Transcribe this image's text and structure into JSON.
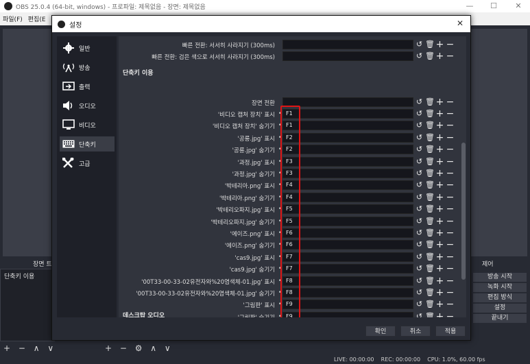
{
  "window": {
    "title": "OBS 25.0.4 (64-bit, windows) - 프로파일: 제목없음 - 장면: 제목없음",
    "minimize": "—",
    "maximize": "☐",
    "close": "✕"
  },
  "menu": {
    "file": "파일(F)",
    "edit": "편집(E"
  },
  "docks": {
    "scenes_title": "장면 트",
    "scene_item": "단축키 이용",
    "controls_title": "제어",
    "controls": [
      "방송 시작",
      "녹화 시작",
      "편집 방식",
      "설정",
      "끝내기"
    ],
    "bottom_left_tools": "+ − ∧ ∨",
    "bottom_mid_tools": "+ − ⚙ ∧ ∨"
  },
  "status": {
    "text": "LIVE: 00:00:00    REC: 00:00:00    CPU: 1.0%, 60.00 fps"
  },
  "dialog": {
    "title": "설정",
    "close": "✕",
    "sidebar": [
      {
        "label": "일반",
        "icon": "gear-icon"
      },
      {
        "label": "방송",
        "icon": "broadcast-icon"
      },
      {
        "label": "출력",
        "icon": "output-icon"
      },
      {
        "label": "오디오",
        "icon": "speaker-icon"
      },
      {
        "label": "비디오",
        "icon": "monitor-icon"
      },
      {
        "label": "단축키",
        "icon": "keyboard-icon",
        "active": true
      },
      {
        "label": "고급",
        "icon": "tools-icon"
      }
    ],
    "top_rows": [
      {
        "label": "빠른 전환: 서서히 사라지기 (300ms)",
        "key": ""
      },
      {
        "label": "빠른 전환: 검은 색으로 서서히 사라지기 (300ms)",
        "key": ""
      }
    ],
    "section_hotkeys": "단축키 이용",
    "scene_switch_label": "장면 전환",
    "hotkeys": [
      {
        "label": "'비디오 캡처 장치' 표시",
        "key": "F1"
      },
      {
        "label": "'비디오 캡처 장치' 숨기기",
        "key": "F1"
      },
      {
        "label": "'공룡.jpg' 표시",
        "key": "F2"
      },
      {
        "label": "'공룡.jpg' 숨기기",
        "key": "F2"
      },
      {
        "label": "'과정.jpg' 표시",
        "key": "F3"
      },
      {
        "label": "'과정.jpg' 숨기기",
        "key": "F3"
      },
      {
        "label": "'박테리아.png' 표시",
        "key": "F4"
      },
      {
        "label": "'박테리아.png' 숨기기",
        "key": "F4"
      },
      {
        "label": "'박테리오파지.jpg' 표시",
        "key": "F5"
      },
      {
        "label": "'박테리오파지.jpg' 숨기기",
        "key": "F5"
      },
      {
        "label": "'에이즈.png' 표시",
        "key": "F6"
      },
      {
        "label": "'에이즈.png' 숨기기",
        "key": "F6"
      },
      {
        "label": "'cas9.jpg' 표시",
        "key": "F7"
      },
      {
        "label": "'cas9.jpg' 숨기기",
        "key": "F7"
      },
      {
        "label": "'00T33-00-33-02유전자와%20염색체-01.jpg' 표시",
        "key": "F8"
      },
      {
        "label": "'00T33-00-33-02유전자와%20염색체-01.jpg' 숨기기",
        "key": "F8"
      },
      {
        "label": "'그림판' 표시",
        "key": "F9"
      },
      {
        "label": "'그림판' 숨기기",
        "key": "F9"
      }
    ],
    "section_desktop_audio": "데스크탑 오디오",
    "row_icons": {
      "reset": "↺",
      "delete": "🗑",
      "add": "+",
      "remove": "−"
    },
    "buttons": {
      "ok": "확인",
      "cancel": "취소",
      "apply": "적용"
    }
  }
}
